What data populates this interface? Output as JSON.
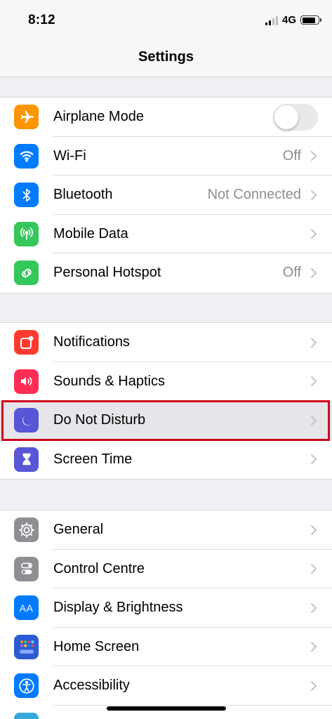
{
  "status_bar": {
    "time": "8:12",
    "network": "4G"
  },
  "nav": {
    "title": "Settings"
  },
  "groups": [
    {
      "items": [
        {
          "label": "Airplane Mode",
          "icon": "airplane-icon",
          "color": "#ff9500",
          "control": "toggle",
          "toggle_on": false
        },
        {
          "label": "Wi-Fi",
          "icon": "wifi-icon",
          "color": "#007aff",
          "value": "Off"
        },
        {
          "label": "Bluetooth",
          "icon": "bluetooth-icon",
          "color": "#007aff",
          "value": "Not Connected"
        },
        {
          "label": "Mobile Data",
          "icon": "antenna-icon",
          "color": "#34c759",
          "value": ""
        },
        {
          "label": "Personal Hotspot",
          "icon": "hotspot-link-icon",
          "color": "#34c759",
          "value": "Off"
        }
      ]
    },
    {
      "items": [
        {
          "label": "Notifications",
          "icon": "notifications-icon",
          "color": "#ff3b30",
          "value": ""
        },
        {
          "label": "Sounds & Haptics",
          "icon": "speaker-icon",
          "color": "#ff2d55",
          "value": ""
        },
        {
          "label": "Do Not Disturb",
          "icon": "moon-icon",
          "color": "#5856d6",
          "value": "",
          "highlighted": true
        },
        {
          "label": "Screen Time",
          "icon": "hourglass-icon",
          "color": "#5856d6",
          "value": ""
        }
      ]
    },
    {
      "items": [
        {
          "label": "General",
          "icon": "gear-icon",
          "color": "#8e8e93",
          "value": ""
        },
        {
          "label": "Control Centre",
          "icon": "switches-icon",
          "color": "#8e8e93",
          "value": ""
        },
        {
          "label": "Display & Brightness",
          "icon": "text-size-icon",
          "color": "#007aff",
          "value": "",
          "icon_text": "AA"
        },
        {
          "label": "Home Screen",
          "icon": "home-screen-grid-icon",
          "color": "#2c5bd4",
          "value": ""
        },
        {
          "label": "Accessibility",
          "icon": "accessibility-icon",
          "color": "#007aff",
          "value": ""
        }
      ]
    }
  ],
  "highlight_color": "#d0021b"
}
